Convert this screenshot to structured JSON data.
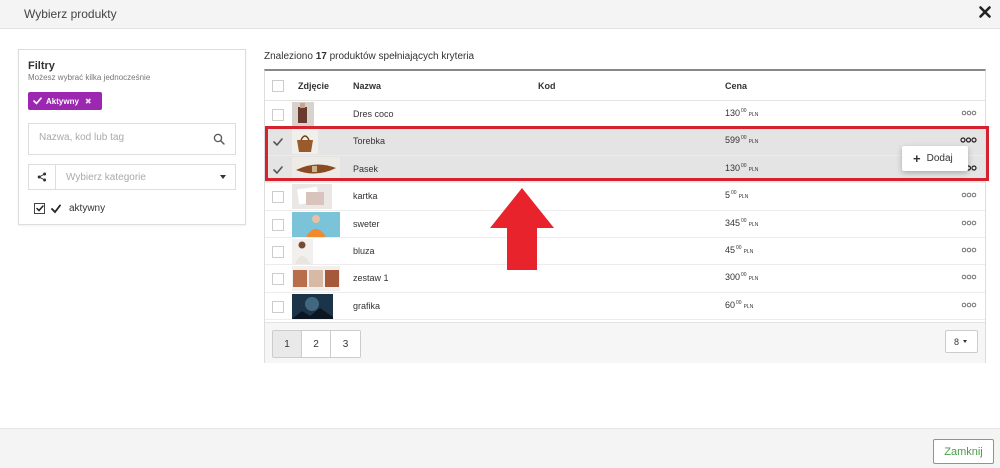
{
  "modal": {
    "title": "Wybierz produkty",
    "close_label": "Zamknij"
  },
  "filters": {
    "title": "Filtry",
    "subtitle": "Możesz wybrać kilka jednocześnie",
    "tag_label": "Aktywny",
    "tag_remove": "✖",
    "search_placeholder": "Nazwa, kod lub tag",
    "category_placeholder": "Wybierz kategorie",
    "checkbox_label": "aktywny"
  },
  "results": {
    "prefix": "Znaleziono ",
    "count": "17",
    "suffix": " produktów spełniających kryteria"
  },
  "table": {
    "columns": {
      "photo": "Zdjęcie",
      "name": "Nazwa",
      "code": "Kod",
      "price": "Cena"
    },
    "rows": [
      {
        "name": "Dres coco",
        "code": "",
        "price_int": "130",
        "price_dec": "00",
        "currency": "PLN",
        "selected": false
      },
      {
        "name": "Torebka",
        "code": "",
        "price_int": "599",
        "price_dec": "00",
        "currency": "PLN",
        "selected": true
      },
      {
        "name": "Pasek",
        "code": "",
        "price_int": "130",
        "price_dec": "00",
        "currency": "PLN",
        "selected": true
      },
      {
        "name": "kartka",
        "code": "",
        "price_int": "5",
        "price_dec": "00",
        "currency": "PLN",
        "selected": false
      },
      {
        "name": "sweter",
        "code": "",
        "price_int": "345",
        "price_dec": "00",
        "currency": "PLN",
        "selected": false
      },
      {
        "name": "bluza",
        "code": "",
        "price_int": "45",
        "price_dec": "00",
        "currency": "PLN",
        "selected": false
      },
      {
        "name": "zestaw 1",
        "code": "",
        "price_int": "300",
        "price_dec": "00",
        "currency": "PLN",
        "selected": false
      },
      {
        "name": "grafika",
        "code": "",
        "price_int": "60",
        "price_dec": "00",
        "currency": "PLN",
        "selected": false
      }
    ]
  },
  "context_menu": {
    "add_label": "Dodaj",
    "add_icon": "+"
  },
  "pagination": {
    "pages": [
      "1",
      "2",
      "3"
    ],
    "active_page": "1",
    "per_page": "8"
  },
  "colors": {
    "accent_purple": "#9c27b0",
    "highlight_red": "#d4222e",
    "footer_green": "#5cb85c",
    "arrow_red": "#e8232c"
  },
  "icons": {
    "close": "close-icon",
    "search": "search-icon",
    "category": "share-icon",
    "tag_check": "check-icon",
    "row_menu": "more-dots-icon",
    "annotation": "red-arrow-up"
  }
}
